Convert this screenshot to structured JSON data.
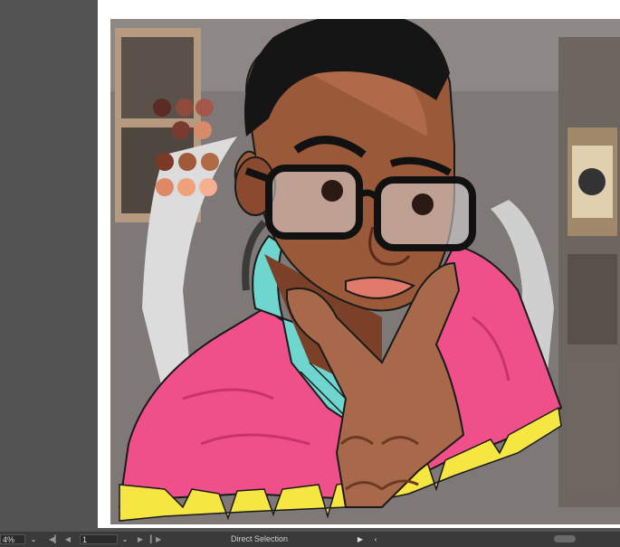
{
  "statusbar": {
    "zoom_value": "4%",
    "artboard_number": "1",
    "tool_status": "Direct Selection"
  },
  "icons": {
    "zoom_dropdown": "chevron-down-icon",
    "artboard_first": "first-page-icon",
    "artboard_prev": "previous-page-icon",
    "artboard_next": "next-page-icon",
    "artboard_last": "last-page-icon",
    "status_menu": "play-triangle-icon",
    "scroll_left": "chevron-left-icon"
  },
  "colors": {
    "pasteboard": "#535353",
    "statusbar": "#3a3a3a",
    "shirt_pink": "#f0508a",
    "drip_yellow": "#f5e642",
    "headphone_teal": "#6fd6cf",
    "skin": "#9a5a3a"
  },
  "swatches": {
    "rows": [
      [
        "#5a2a24",
        "#8e4a3a",
        "#a3584b"
      ],
      [
        "#7a3a2e",
        "#d88a6a"
      ],
      [
        "#7a3a26",
        "#a05a3a",
        "#b06a44"
      ],
      [
        "#e08866",
        "#f0a07a",
        "#f4b090"
      ]
    ]
  }
}
